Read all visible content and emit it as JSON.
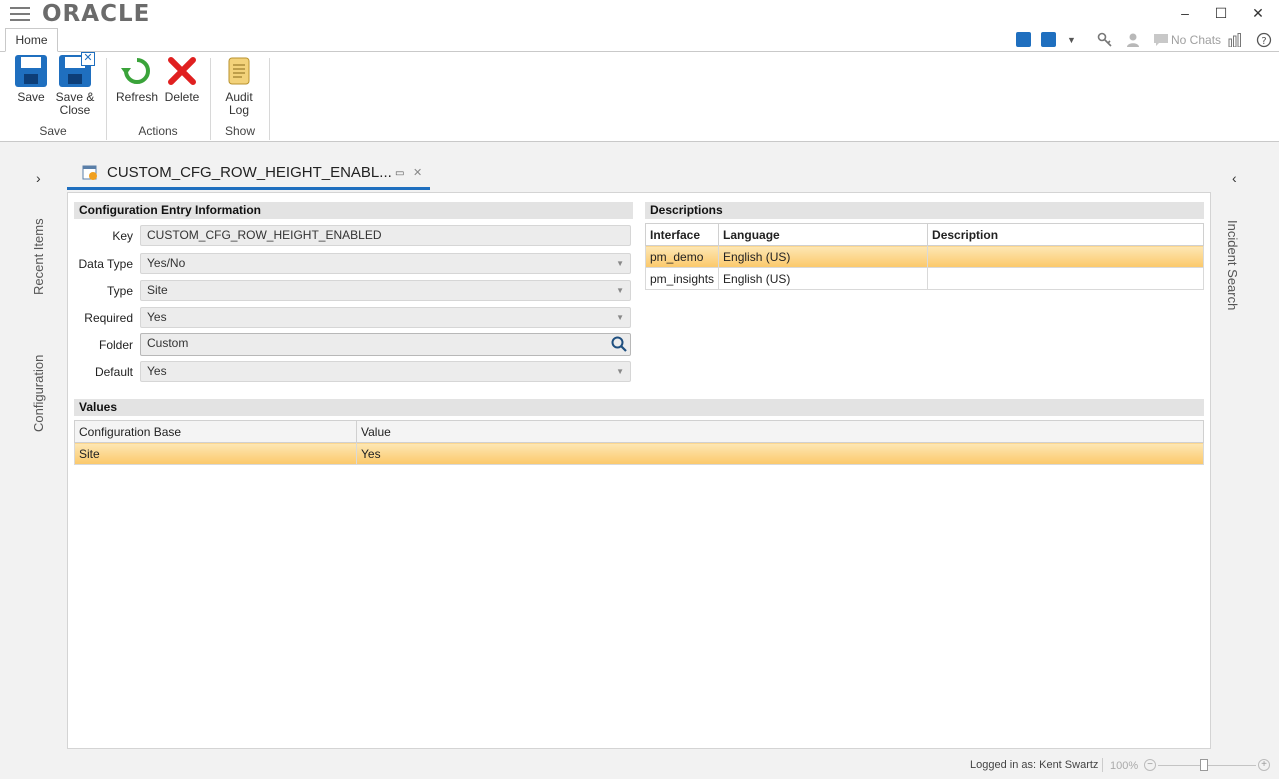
{
  "app": {
    "logo": "ORACLE"
  },
  "window_controls": {
    "minimize": "–",
    "maximize": "☐",
    "close": "✕"
  },
  "tabs": {
    "home": "Home"
  },
  "title_tools": {
    "chat_status": "No Chats"
  },
  "ribbon": {
    "groups": [
      {
        "label": "Save",
        "buttons": [
          "Save",
          "Save & Close"
        ]
      },
      {
        "label": "Actions",
        "buttons": [
          "Refresh",
          "Delete"
        ]
      },
      {
        "label": "Show",
        "buttons": [
          "Audit Log"
        ]
      }
    ],
    "save_label": "Save",
    "save_close_label_1": "Save &",
    "save_close_label_2": "Close",
    "refresh_label": "Refresh",
    "delete_label": "Delete",
    "audit_label_1": "Audit",
    "audit_label_2": "Log",
    "group_save": "Save",
    "group_actions": "Actions",
    "group_show": "Show"
  },
  "side_panels": {
    "recent": "Recent Items",
    "configuration": "Configuration",
    "incident_search": "Incident Search"
  },
  "doc_tab": {
    "title": "CUSTOM_CFG_ROW_HEIGHT_ENABL..."
  },
  "config_info": {
    "header": "Configuration Entry Information",
    "key_label": "Key",
    "key_value": "CUSTOM_CFG_ROW_HEIGHT_ENABLED",
    "datatype_label": "Data Type",
    "datatype_value": "Yes/No",
    "type_label": "Type",
    "type_value": "Site",
    "required_label": "Required",
    "required_value": "Yes",
    "folder_label": "Folder",
    "folder_value": "Custom",
    "default_label": "Default",
    "default_value": "Yes"
  },
  "descriptions": {
    "header": "Descriptions",
    "columns": [
      "Interface",
      "Language",
      "Description"
    ],
    "rows": [
      [
        "pm_demo",
        "English (US)",
        ""
      ],
      [
        "pm_insights",
        "English (US)",
        ""
      ]
    ]
  },
  "values": {
    "header": "Values",
    "columns": [
      "Configuration Base",
      "Value"
    ],
    "rows": [
      [
        "Site",
        "Yes"
      ]
    ]
  },
  "status": {
    "logged_in": "Logged in as: Kent Swartz",
    "zoom": "100%"
  },
  "colors": {
    "accent": "#1f6fbf",
    "selection": "#fbc86a"
  }
}
